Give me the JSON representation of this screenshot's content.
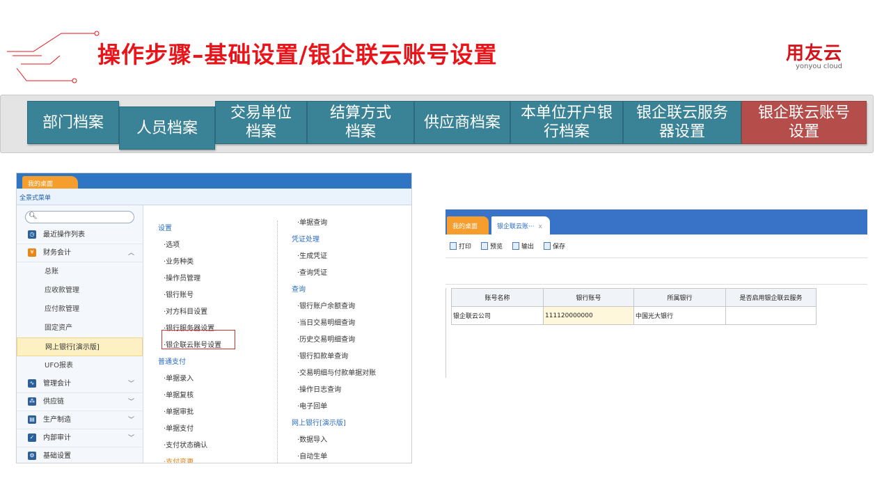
{
  "header": {
    "title": "操作步骤–基础设置/银企联云账号设置",
    "logo_cn": "用友云",
    "logo_en": "yonyou cloud"
  },
  "tabs": [
    {
      "label": "部门档案"
    },
    {
      "label": "人员档案"
    },
    {
      "label": "交易单位档案"
    },
    {
      "label": "结算方式档案"
    },
    {
      "label": "供应商档案"
    },
    {
      "label": "本单位开户银行档案"
    },
    {
      "label": "银企联云服务器设置"
    },
    {
      "label": "银企联云账号设置",
      "active": true
    }
  ],
  "left_app": {
    "desk_tab": "我的桌面",
    "menu_label": "全景式菜单",
    "sidebar": {
      "recent": "最近操作列表",
      "finance": "财务会计",
      "subs": [
        "总账",
        "应收款管理",
        "应付款管理",
        "固定资产",
        "网上银行[演示版]",
        "UFO报表"
      ],
      "mgmt": "管理会计",
      "supply": "供应链",
      "production": "生产制造",
      "audit": "内部审计",
      "basic": "基础设置"
    },
    "col1": [
      {
        "t": "设置",
        "h": true
      },
      {
        "t": "·选项"
      },
      {
        "t": "·业务种类"
      },
      {
        "t": "·操作员管理"
      },
      {
        "t": "·银行账号"
      },
      {
        "t": "·对方科目设置"
      },
      {
        "t": "·银行服务器设置"
      },
      {
        "t": "·银企联云账号设置"
      },
      {
        "t": "普通支付",
        "h": true
      },
      {
        "t": "·单据录入"
      },
      {
        "t": "·单据复核"
      },
      {
        "t": "·单据审批"
      },
      {
        "t": "·单据支付"
      },
      {
        "t": "·支付状态确认"
      },
      {
        "t": "·支付变更",
        "o": true
      }
    ],
    "col2": [
      {
        "t": "·单据查询"
      },
      {
        "t": "凭证处理",
        "h": true
      },
      {
        "t": "·生成凭证"
      },
      {
        "t": "·查询凭证"
      },
      {
        "t": "查询",
        "h": true
      },
      {
        "t": "·银行账户余额查询"
      },
      {
        "t": "·当日交易明细查询"
      },
      {
        "t": "·历史交易明细查询"
      },
      {
        "t": "·银行扣款单查询"
      },
      {
        "t": "·交易明细与付款单据对账"
      },
      {
        "t": "·操作日志查询"
      },
      {
        "t": "·电子回单"
      },
      {
        "t": "网上银行[演示版]",
        "h": true
      },
      {
        "t": "·数据导入"
      },
      {
        "t": "·自动生单"
      }
    ]
  },
  "right_app": {
    "tab1": "我的桌面",
    "tab2": "银企联云账···",
    "tab2_close": "x",
    "toolbar": {
      "print": "打印",
      "preview": "预览",
      "export": "输出",
      "save": "保存"
    },
    "table": {
      "headers": [
        "账号名称",
        "银行账号",
        "所属银行",
        "是否启用银企联云服务"
      ],
      "rows": [
        [
          "银企联云公司",
          "111120000000",
          "中国光大银行",
          ""
        ]
      ]
    }
  }
}
